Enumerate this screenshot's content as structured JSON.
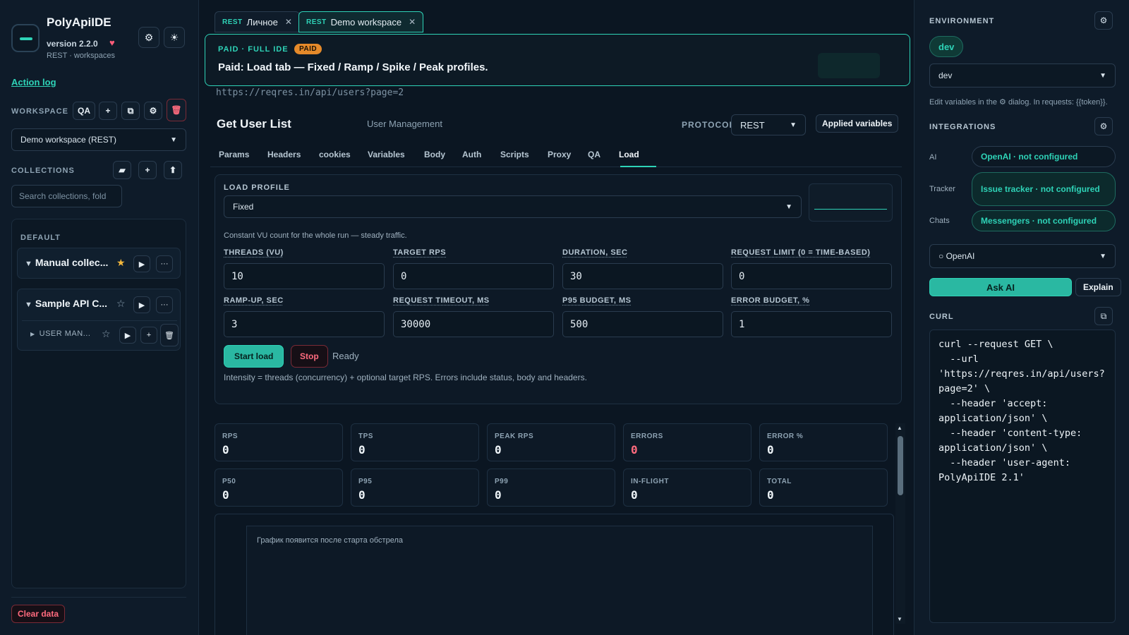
{
  "app": {
    "title": "PolyApiIDE",
    "version": "version 2.2.0",
    "subtitle": "REST · workspaces",
    "action_log": "Action log",
    "clear_data": "Clear data"
  },
  "workspace": {
    "label": "WORKSPACE",
    "qa_label": "QA",
    "selected": "Demo workspace (REST)"
  },
  "collections": {
    "label": "COLLECTIONS",
    "search_placeholder": "Search collections, fold",
    "group": "DEFAULT",
    "items": [
      {
        "name": "Manual collec...",
        "starred": true
      },
      {
        "name": "Sample API C...",
        "starred": false
      }
    ],
    "subfolder": "USER MAN..."
  },
  "tabs": [
    {
      "kind": "REST",
      "label": "Личное",
      "active": false
    },
    {
      "kind": "REST",
      "label": "Demo workspace",
      "active": true
    }
  ],
  "banner": {
    "kicker": "PAID · FULL IDE",
    "badge": "PAID",
    "title": "Paid: Load tab — Fixed / Ramp / Spike / Peak profiles."
  },
  "request": {
    "url": "https://reqres.in/api/users?page=2",
    "title": "Get User List",
    "folder": "User Management",
    "protocol_label": "PROTOCOL",
    "protocol": "REST",
    "applied_variables": "Applied variables"
  },
  "subtabs": [
    "Params",
    "Headers",
    "cookies",
    "Variables",
    "Body",
    "Auth",
    "Scripts",
    "Proxy",
    "QA",
    "Load"
  ],
  "active_subtab": "Load",
  "load": {
    "profile_label": "LOAD PROFILE",
    "profile": "Fixed",
    "description": "Constant VU count for the whole run — steady traffic.",
    "fields": [
      {
        "label": "THREADS (VU)",
        "value": "10"
      },
      {
        "label": "TARGET RPS",
        "value": "0"
      },
      {
        "label": "DURATION, SEC",
        "value": "30"
      },
      {
        "label": "REQUEST LIMIT (0 = TIME-BASED)",
        "value": "0"
      },
      {
        "label": "RAMP-UP, SEC",
        "value": "3"
      },
      {
        "label": "REQUEST TIMEOUT, MS",
        "value": "30000"
      },
      {
        "label": "P95 BUDGET, MS",
        "value": "500"
      },
      {
        "label": "ERROR BUDGET, %",
        "value": "1"
      }
    ],
    "start": "Start load",
    "stop": "Stop",
    "status": "Ready",
    "intensity_note": "Intensity = threads (concurrency) + optional target RPS. Errors include status, body and headers."
  },
  "stats": [
    {
      "label": "RPS",
      "value": "0"
    },
    {
      "label": "TPS",
      "value": "0"
    },
    {
      "label": "PEAK RPS",
      "value": "0"
    },
    {
      "label": "ERRORS",
      "value": "0"
    },
    {
      "label": "ERROR %",
      "value": "0"
    },
    {
      "label": "P50",
      "value": "0"
    },
    {
      "label": "P95",
      "value": "0"
    },
    {
      "label": "P99",
      "value": "0"
    },
    {
      "label": "IN-FLIGHT",
      "value": "0"
    },
    {
      "label": "TOTAL",
      "value": "0"
    }
  ],
  "chart_placeholder": "График появится после старта обстрела",
  "environment": {
    "label": "ENVIRONMENT",
    "chip": "dev",
    "selected": "dev",
    "note": "Edit variables in the ⚙ dialog. In requests: {{token}}."
  },
  "integrations": {
    "label": "INTEGRATIONS",
    "items": [
      {
        "label": "AI",
        "value": "OpenAI · not configured"
      },
      {
        "label": "Tracker",
        "value": "Issue tracker · not configured"
      },
      {
        "label": "Chats",
        "value": "Messengers · not configured"
      }
    ],
    "provider": "○ OpenAI",
    "ask": "Ask AI",
    "explain": "Explain"
  },
  "curl": {
    "label": "CURL",
    "code": "curl --request GET \\\n  --url\n'https://reqres.in/api/users?page=2' \\\n  --header 'accept:\napplication/json' \\\n  --header 'content-type:\napplication/json' \\\n  --header 'user-agent:\nPolyApiIDE 2.1'"
  },
  "colors": {
    "accent": "#2ed3b7",
    "danger": "#ff6b7e",
    "paid_badge": "#e58a2a",
    "background": "#0b1622"
  }
}
